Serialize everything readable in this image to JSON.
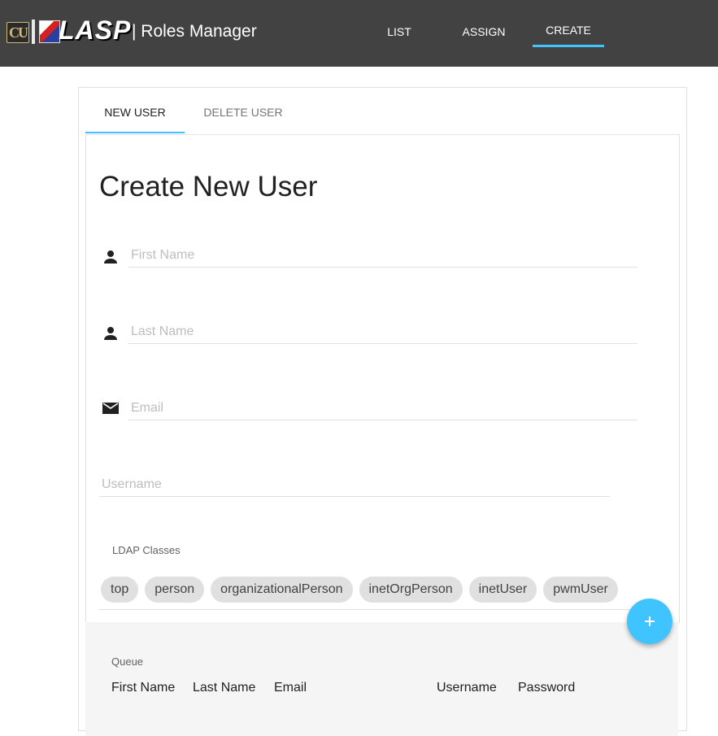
{
  "header": {
    "logo_text": "LASP",
    "logo_cu_text": "CU",
    "app_title": "| Roles Manager",
    "tabs": [
      {
        "label": "LIST",
        "active": false
      },
      {
        "label": "ASSIGN",
        "active": false
      },
      {
        "label": "CREATE",
        "active": true
      }
    ],
    "accent_color": "#40c4ff",
    "background_color": "#424242"
  },
  "subtabs": [
    {
      "label": "NEW USER",
      "active": true
    },
    {
      "label": "DELETE USER",
      "active": false
    }
  ],
  "form": {
    "title": "Create New User",
    "fields": {
      "first_name": {
        "placeholder": "First Name",
        "value": "",
        "icon": "person-icon"
      },
      "last_name": {
        "placeholder": "Last Name",
        "value": "",
        "icon": "person-icon"
      },
      "email": {
        "placeholder": "Email",
        "value": "",
        "icon": "email-icon"
      },
      "username": {
        "placeholder": "Username",
        "value": ""
      }
    },
    "ldap_label": "LDAP Classes",
    "ldap_classes": [
      "top",
      "person",
      "organizationalPerson",
      "inetOrgPerson",
      "inetUser",
      "pwmUser"
    ]
  },
  "queue": {
    "title": "Queue",
    "columns": [
      "First Name",
      "Last Name",
      "Email",
      "Username",
      "Password"
    ]
  },
  "fab": {
    "icon": "plus-icon"
  }
}
